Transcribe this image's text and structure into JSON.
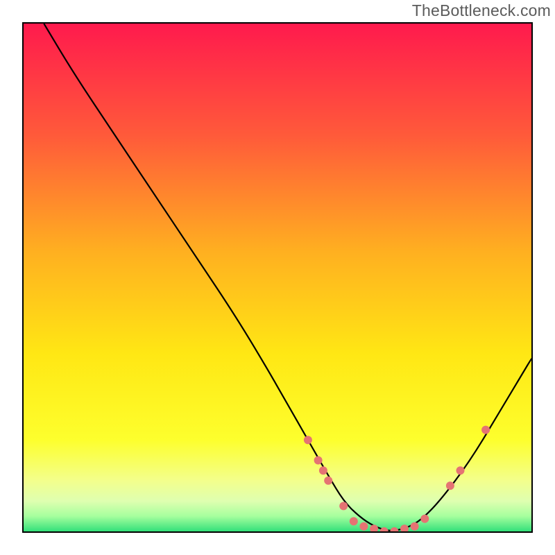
{
  "watermark": "TheBottleneck.com",
  "chart_data": {
    "type": "line",
    "title": "",
    "xlabel": "",
    "ylabel": "",
    "xlim": [
      0,
      100
    ],
    "ylim": [
      0,
      100
    ],
    "grid": false,
    "legend": false,
    "gradient_stops": [
      {
        "pos": 0.0,
        "color": "#ff1a4d"
      },
      {
        "pos": 0.22,
        "color": "#ff5a3a"
      },
      {
        "pos": 0.45,
        "color": "#ffb020"
      },
      {
        "pos": 0.65,
        "color": "#ffe714"
      },
      {
        "pos": 0.82,
        "color": "#fdff2d"
      },
      {
        "pos": 0.9,
        "color": "#f3ff8c"
      },
      {
        "pos": 0.94,
        "color": "#dfffb0"
      },
      {
        "pos": 0.97,
        "color": "#a6ff9e"
      },
      {
        "pos": 1.0,
        "color": "#33e07a"
      }
    ],
    "series": [
      {
        "name": "bottleneck-curve",
        "stroke": "#000000",
        "stroke_width": 2.2,
        "x": [
          4,
          10,
          18,
          26,
          34,
          42,
          48,
          52,
          56,
          60,
          63,
          66,
          69,
          72,
          75,
          78,
          82,
          88,
          94,
          100
        ],
        "y": [
          100,
          90,
          78,
          66,
          54,
          42,
          32,
          25,
          18,
          11,
          6,
          3,
          1,
          0,
          0.5,
          2,
          6,
          14,
          24,
          34
        ]
      }
    ],
    "markers": {
      "name": "highlight-dots",
      "color": "#e57373",
      "radius": 6,
      "points": [
        {
          "x": 56,
          "y": 18
        },
        {
          "x": 58,
          "y": 14
        },
        {
          "x": 59,
          "y": 12
        },
        {
          "x": 60,
          "y": 10
        },
        {
          "x": 63,
          "y": 5
        },
        {
          "x": 65,
          "y": 2
        },
        {
          "x": 67,
          "y": 1
        },
        {
          "x": 69,
          "y": 0.5
        },
        {
          "x": 71,
          "y": 0
        },
        {
          "x": 73,
          "y": 0
        },
        {
          "x": 75,
          "y": 0.5
        },
        {
          "x": 77,
          "y": 1
        },
        {
          "x": 79,
          "y": 2.5
        },
        {
          "x": 84,
          "y": 9
        },
        {
          "x": 86,
          "y": 12
        },
        {
          "x": 91,
          "y": 20
        }
      ]
    }
  }
}
